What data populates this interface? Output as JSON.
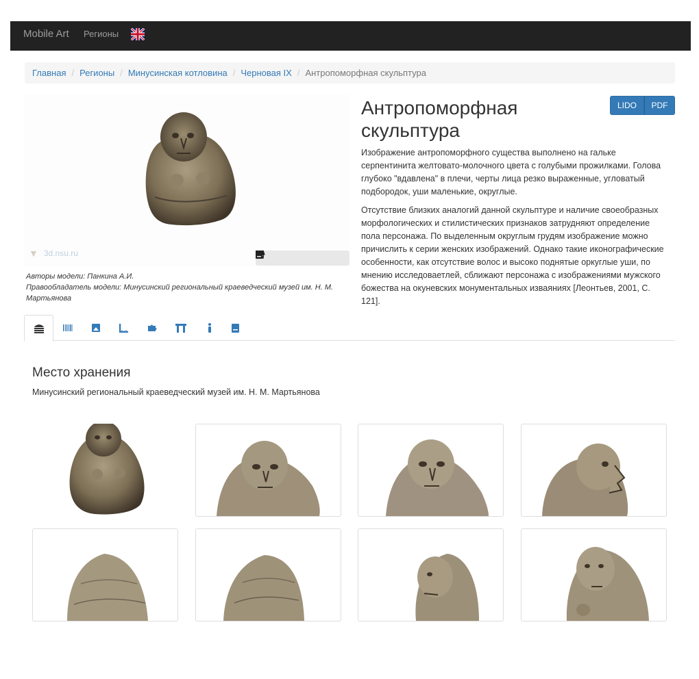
{
  "navbar": {
    "brand": "Mobile Art",
    "regions": "Регионы"
  },
  "breadcrumb": {
    "items": [
      "Главная",
      "Регионы",
      "Минусинская котловина",
      "Черновая IX"
    ],
    "active": "Антропоморфная скульптура",
    "separator": "/"
  },
  "viewer": {
    "watermark": "3d.nsu.ru",
    "toolbar_icons": [
      "ruler-icon",
      "image-icon",
      "light-icon",
      "book-icon",
      "fullscreen-icon"
    ]
  },
  "credits": {
    "authors": "Авторы модели: Панкина А.И.",
    "owner": "Правообладатель модели: Минусинский региональный краеведческий музей им. Н. М. Мартьянова"
  },
  "header": {
    "title": "Антропоморфная скульптура"
  },
  "export": {
    "lido": "LIDO",
    "pdf": "PDF"
  },
  "description": {
    "p1": "Изображение  антропоморфного существа выполнено на гальке серпентинита желтовато-молочного цвета с голубыми прожилками. Голова глубоко \"вдавлена\" в плечи, черты лица резко выраженные, угловатый подбородок, уши маленькие, округлые.",
    "p2": "Отсутствие близких аналогий данной скульптуре и наличие своеобразных морфологических и стилистических признаков затрудняют определение пола персонажа. По выделенным округлым грудям изображение можно причислить к серии женских изображений. Однако такие иконографические особенности, как отсутствие волос и высоко поднятые оркуглые уши, по мнению исследоваетлей, сближают персонажа с изображениями мужского божества на окуневских монументальных изваяниях [Леонтьев, 2001, С. 121]."
  },
  "tabs": [
    "museum-tab",
    "barcode-tab",
    "image-tab",
    "measure-tab",
    "map-tab",
    "gate-tab",
    "person-tab",
    "book-tab"
  ],
  "storage": {
    "title": "Место хранения",
    "museum": "Минусинский региональный краеведческий музей им. Н. М. Мартьянова"
  },
  "colors": {
    "link": "#337ab7",
    "navbar": "#222222",
    "button": "#337ab7"
  }
}
